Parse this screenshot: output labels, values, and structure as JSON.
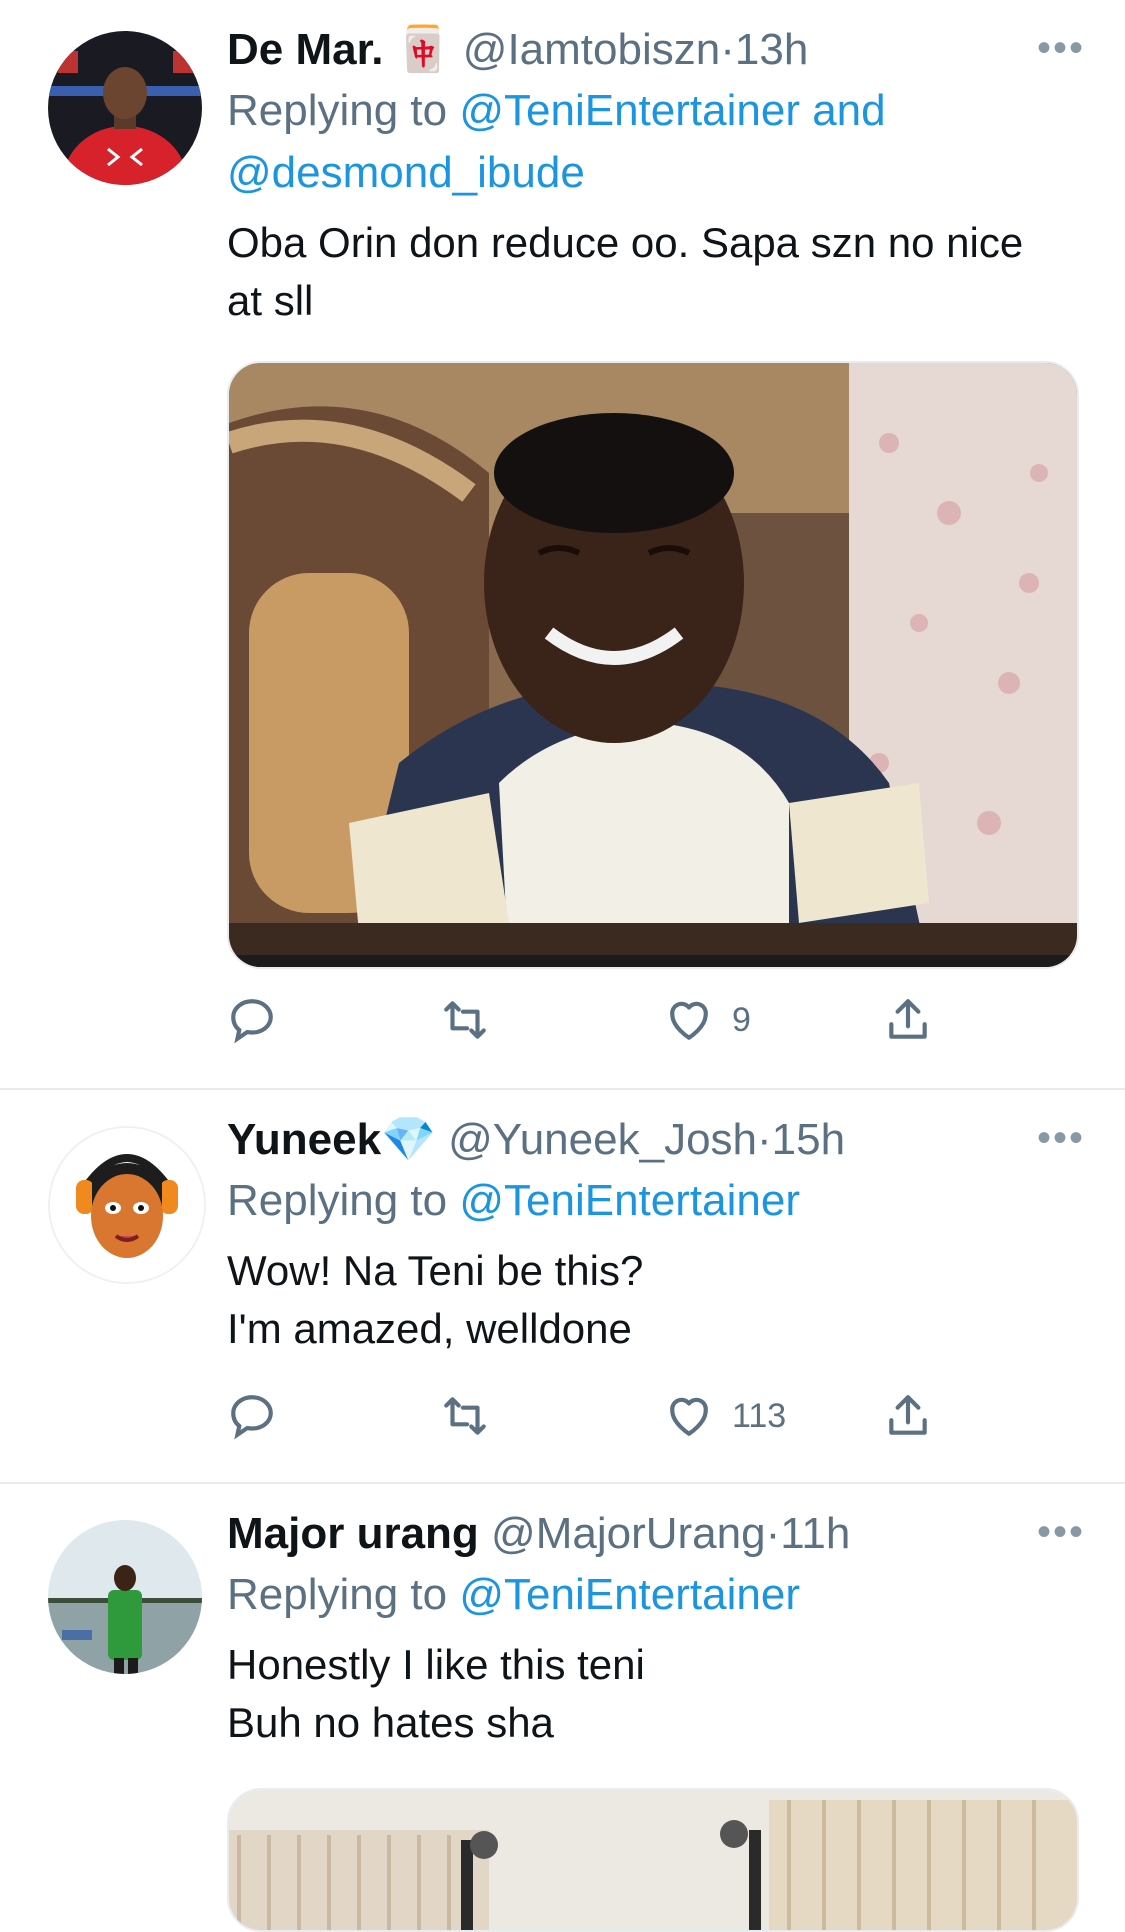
{
  "tweets": [
    {
      "name": "De Mar.",
      "emoji": "🀄",
      "handle": "@Iamtobiszn",
      "dot": "·",
      "time": "13h",
      "reply_prefix": "Replying to ",
      "reply_mentions": "@TeniEntertainer and @desmond_ibude",
      "text": "Oba Orin don reduce oo. Sapa szn no nice at sll",
      "reply_count": "",
      "retweet_count": "",
      "like_count": "9",
      "more": "•••"
    },
    {
      "name": "Yuneek",
      "emoji": "💎",
      "handle": "@Yuneek_Josh",
      "dot": "·",
      "time": "15h",
      "reply_prefix": "Replying to ",
      "reply_mentions": "@TeniEntertainer",
      "text": "Wow! Na Teni be this?\nI'm amazed, welldone",
      "reply_count": "",
      "retweet_count": "",
      "like_count": "113",
      "more": "•••"
    },
    {
      "name": "Major urang",
      "emoji": "",
      "handle": "@MajorUrang",
      "dot": "·",
      "time": "11h",
      "reply_prefix": "Replying to ",
      "reply_mentions": "@TeniEntertainer",
      "text": "Honestly I like this teni\nBuh no hates sha",
      "reply_count": "",
      "retweet_count": "",
      "like_count": "",
      "more": "•••"
    }
  ],
  "icons": {
    "reply": "reply-icon",
    "retweet": "retweet-icon",
    "like": "heart-icon",
    "share": "share-icon"
  },
  "colors": {
    "link": "#1b95e0",
    "secondary": "#5b7083",
    "divider": "#e6ecf0"
  }
}
